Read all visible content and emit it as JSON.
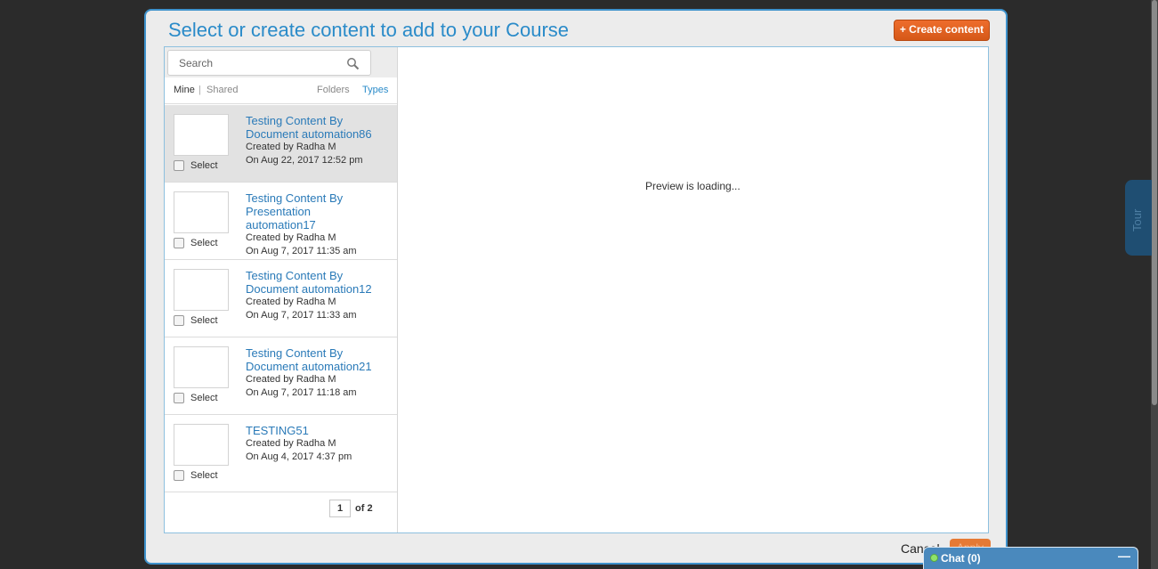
{
  "dialog": {
    "title": "Select or create content to add to your Course",
    "create_button": "+ Create content"
  },
  "search": {
    "placeholder": "Search"
  },
  "filters": {
    "mine": "Mine",
    "separator": "|",
    "shared": "Shared",
    "folders": "Folders",
    "types": "Types"
  },
  "items": [
    {
      "title": "Testing Content By Document automation86",
      "author": "Created by Radha M",
      "date": "On Aug 22, 2017 12:52 pm",
      "select_label": "Select"
    },
    {
      "title": "Testing Content By Presentation automation17",
      "author": "Created by Radha M",
      "date": "On Aug 7, 2017 11:35 am",
      "select_label": "Select"
    },
    {
      "title": "Testing Content By Document automation12",
      "author": "Created by Radha M",
      "date": "On Aug 7, 2017 11:33 am",
      "select_label": "Select"
    },
    {
      "title": "Testing Content By Document automation21",
      "author": "Created by Radha M",
      "date": "On Aug 7, 2017 11:18 am",
      "select_label": "Select"
    },
    {
      "title": "TESTING51",
      "author": "Created by Radha M",
      "date": "On Aug 4, 2017 4:37 pm",
      "select_label": "Select"
    }
  ],
  "pagination": {
    "current": "1",
    "of_total": "of 2"
  },
  "preview": {
    "status": "Preview is loading..."
  },
  "footer": {
    "cancel": "Cancel",
    "apply": "Apply"
  },
  "chat": {
    "label": "Chat  (0)",
    "minimize": "—"
  },
  "tour": {
    "label": "Tour"
  },
  "colors": {
    "accent": "#2a8bc9",
    "create_button": "#e0621f",
    "chat_bar": "#4a89bd"
  }
}
